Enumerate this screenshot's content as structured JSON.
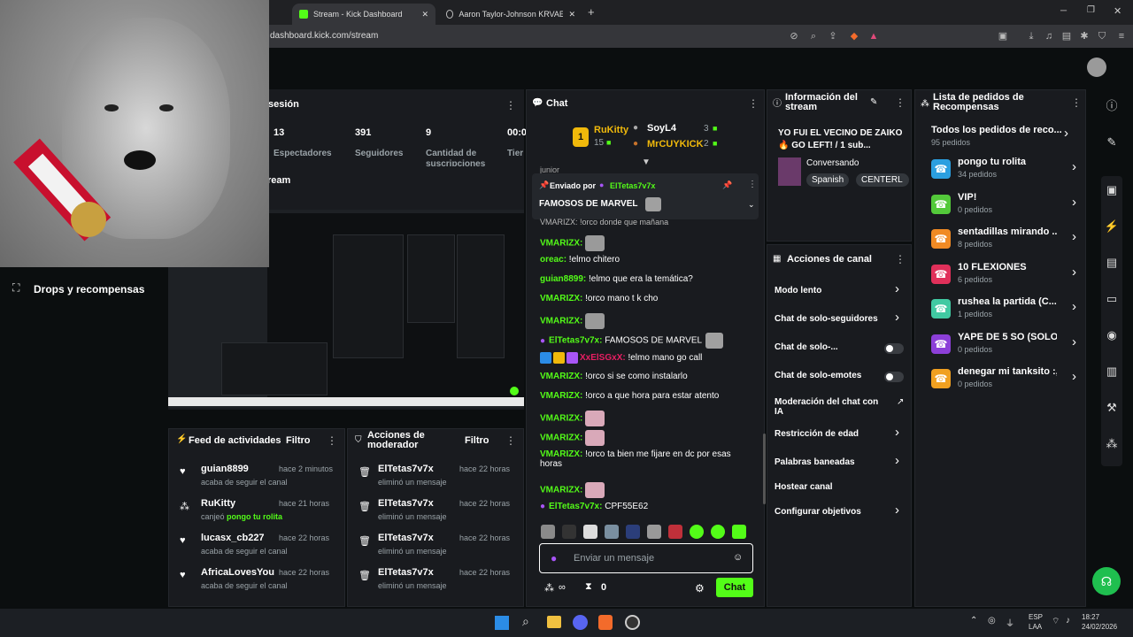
{
  "browser": {
    "tabs": [
      {
        "title": "Stream - Kick Dashboard",
        "active": true
      },
      {
        "title": "Aaron Taylor-Johnson KRVAEN - Bus"
      }
    ],
    "url": "dashboard.kick.com/stream",
    "new_tab": "+"
  },
  "webcam": {
    "label": "Drops y recompensas"
  },
  "session": {
    "title": "sesión",
    "stats": [
      {
        "value": "13",
        "label": "Espectadores"
      },
      {
        "value": "391",
        "label": "Seguidores"
      },
      {
        "value": "9",
        "label": "Cantidad de suscripciones"
      },
      {
        "value": "00:0",
        "label": "Tier"
      }
    ],
    "stream_label": "ream"
  },
  "activity_feed": {
    "title": "Feed de actividades",
    "filter": "Filtro",
    "items": [
      {
        "name": "guian8899",
        "time": "hace 2 minutos",
        "desc": "acaba de seguir el canal",
        "icon": "heart-icon"
      },
      {
        "name": "RuKitty",
        "time": "hace 21 horas",
        "desc": "canjeó ",
        "highlight": "pongo tu rolita",
        "icon": "gift-icon"
      },
      {
        "name": "lucasx_cb227",
        "time": "hace 22 horas",
        "desc": "acaba de seguir el canal",
        "icon": "heart-icon"
      },
      {
        "name": "AfricaLovesYou",
        "time": "hace 22 horas",
        "desc": "acaba de seguir el canal",
        "icon": "heart-icon"
      }
    ]
  },
  "mod_actions": {
    "title": "Acciones de moderador",
    "filter": "Filtro",
    "items": [
      {
        "name": "ElTetas7v7x",
        "time": "hace 22 horas",
        "desc": "eliminó un mensaje"
      },
      {
        "name": "ElTetas7v7x",
        "time": "hace 22 horas",
        "desc": "eliminó un mensaje"
      },
      {
        "name": "ElTetas7v7x",
        "time": "hace 22 horas",
        "desc": "eliminó un mensaje"
      },
      {
        "name": "ElTetas7v7x",
        "time": "hace 22 horas",
        "desc": "eliminó un mensaje"
      }
    ]
  },
  "chat": {
    "title": "Chat",
    "leaders": [
      {
        "rank": "1",
        "name": "RuKitty",
        "count": "15"
      },
      {
        "name": "SoyL4",
        "count": "3"
      },
      {
        "name": "MrCUYKICK",
        "count": "2"
      }
    ],
    "pinned": {
      "by_label": "Enviado por",
      "by": "ElTetas7v7x",
      "text": "FAMOSOS DE MARVEL"
    },
    "partial_top": "junior",
    "partial_under": "VMARIZX: !orco donde que mañana",
    "messages": [
      {
        "user": "VMARIZX",
        "text": "",
        "emote": true
      },
      {
        "user": "oreac",
        "text": "!elmo chitero",
        "color": "#53fc18"
      },
      {
        "user": "guian8899",
        "text": "!elmo que era la temática?",
        "color": "#53fc18"
      },
      {
        "user": "VMARIZX",
        "text": "!orco mano t k cho"
      },
      {
        "user": "VMARIZX",
        "text": "",
        "emote": true
      },
      {
        "user": "ElTetas7v7x",
        "text": "FAMOSOS DE MARVEL",
        "color": "#53fc18",
        "badge": true
      },
      {
        "user": "XxElSGxX",
        "text": "!elmo mano go call",
        "color": "#e91e63",
        "badges": 3
      },
      {
        "user": "VMARIZX",
        "text": "!orco si se como instalarlo"
      },
      {
        "user": "VMARIZX",
        "text": "!orco a que hora para estar atento"
      },
      {
        "user": "VMARIZX",
        "text": "",
        "emote": true
      },
      {
        "user": "VMARIZX",
        "text": "",
        "emote": true
      },
      {
        "user": "VMARIZX",
        "text": "!orco ta bien me fijare en dc por esas",
        "text2": "horas"
      },
      {
        "user": "VMARIZX",
        "text": "",
        "emote": true
      },
      {
        "user": "ElTetas7v7x",
        "text": "CPF55E62",
        "color": "#53fc18",
        "badge": true
      }
    ],
    "input_placeholder": "Enviar un mensaje",
    "points": "0",
    "send_label": "Chat"
  },
  "stream_info": {
    "title": "Información del stream",
    "stream_title": "YO FUI EL VECINO DE ZAIKO 🔥 GO LEFT! / 1 sub...",
    "category": "Conversando",
    "tags": [
      "Spanish",
      "CENTERL"
    ]
  },
  "channel_actions": {
    "title": "Acciones de canal",
    "items": [
      {
        "label": "Modo lento",
        "type": "chevron"
      },
      {
        "label": "Chat de solo-seguidores",
        "type": "chevron"
      },
      {
        "label": "Chat de solo-...",
        "type": "toggle"
      },
      {
        "label": "Chat de solo-emotes",
        "type": "toggle"
      },
      {
        "label": "Moderación del chat con IA",
        "type": "external"
      },
      {
        "label": "Restricción de edad",
        "type": "chevron"
      },
      {
        "label": "Palabras baneadas",
        "type": "chevron"
      },
      {
        "label": "Hostear canal",
        "type": "none"
      },
      {
        "label": "Configurar objetivos",
        "type": "chevron"
      }
    ]
  },
  "rewards": {
    "title": "Lista de pedidos de Recompensas",
    "all": {
      "label": "Todos los pedidos de reco...",
      "sub": "95 pedidos"
    },
    "items": [
      {
        "label": "pongo tu rolita",
        "sub": "34 pedidos",
        "color": "#2b9fe0"
      },
      {
        "label": "VIP!",
        "sub": "0 pedidos",
        "color": "#53c93a"
      },
      {
        "label": "sentadillas mirando ...",
        "sub": "8 pedidos",
        "color": "#f08a24"
      },
      {
        "label": "10 FLEXIONES",
        "sub": "6 pedidos",
        "color": "#e0305a"
      },
      {
        "label": "rushea la partida (C...",
        "sub": "1 pedidos",
        "color": "#41c9a2"
      },
      {
        "label": "YAPE DE 5 SO (SOLO...",
        "sub": "0 pedidos",
        "color": "#8c3fd8"
      },
      {
        "label": "denegar mi tanksito :,v",
        "sub": "0 pedidos",
        "color": "#f0a020"
      }
    ]
  },
  "taskbar": {
    "lang": "ESP",
    "lang2": "LAA",
    "time": "18:27",
    "date": "24/02/2026"
  }
}
